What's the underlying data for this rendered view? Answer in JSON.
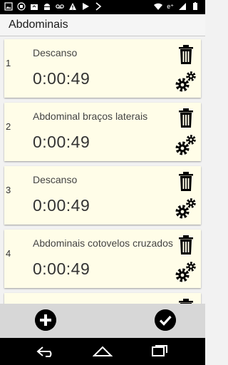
{
  "app": {
    "title": "Abdominais"
  },
  "status_bar": {
    "left_icons": [
      "image-icon",
      "media-icon",
      "shop-icon",
      "android-icon",
      "voicemail-icon",
      "warning-icon",
      "play-icon",
      "download-icon"
    ],
    "right_icons": [
      "wifi-icon",
      "data-icon",
      "signal-icon",
      "battery-icon"
    ],
    "data_label": "e⁺"
  },
  "exercises": [
    {
      "number": "1",
      "name": "Descanso",
      "time": "0:00:49"
    },
    {
      "number": "2",
      "name": "Abdominal braços laterais",
      "time": "0:00:49"
    },
    {
      "number": "3",
      "name": "Descanso",
      "time": "0:00:49"
    },
    {
      "number": "4",
      "name": "Abdominais cotovelos cruzados",
      "time": "0:00:49"
    },
    {
      "number": "",
      "name": "",
      "time": ""
    }
  ],
  "bottom_bar": {
    "add_icon": "add-icon",
    "confirm_icon": "check-icon"
  },
  "nav_bar": {
    "icons": [
      "back-icon",
      "home-icon",
      "recent-apps-icon"
    ]
  },
  "colors": {
    "card_background": "#fffde8",
    "bottom_bar": "#d7d7d7",
    "status_bar": "#000000"
  }
}
